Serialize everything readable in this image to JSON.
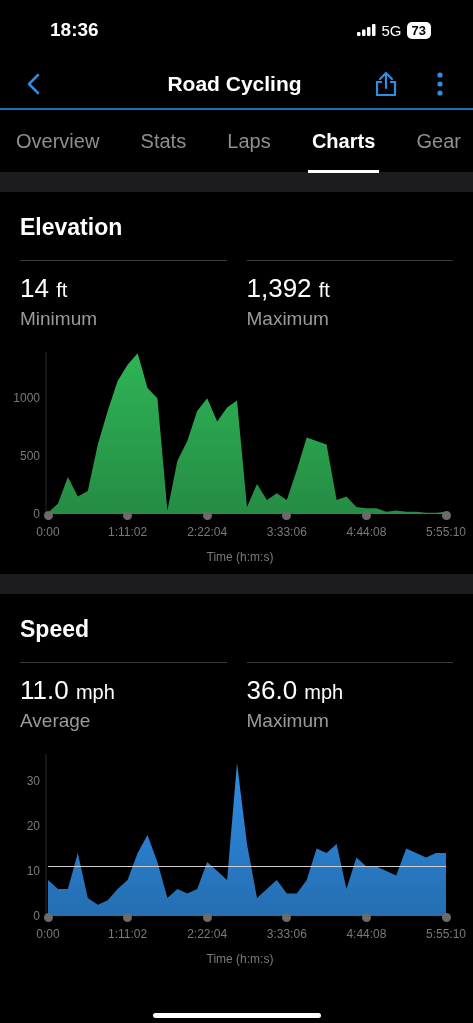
{
  "status_bar": {
    "time": "18:36",
    "network": "5G",
    "battery": "73"
  },
  "nav": {
    "title": "Road Cycling"
  },
  "tabs": [
    {
      "label": "Overview",
      "selected": false
    },
    {
      "label": "Stats",
      "selected": false
    },
    {
      "label": "Laps",
      "selected": false
    },
    {
      "label": "Charts",
      "selected": true
    },
    {
      "label": "Gear",
      "selected": false
    }
  ],
  "sections": [
    {
      "title": "Elevation",
      "stats": [
        {
          "value": "14",
          "unit": "ft",
          "label": "Minimum"
        },
        {
          "value": "1,392",
          "unit": "ft",
          "label": "Maximum"
        }
      ],
      "chart_data": {
        "type": "area",
        "xlabel": "Time (h:m:s)",
        "xlim": [
          0,
          21310
        ],
        "ylim": [
          0,
          1400
        ],
        "x": [
          0,
          533,
          1066,
          1598,
          2131,
          2664,
          3197,
          3729,
          4262,
          4795,
          5328,
          5860,
          6393,
          6926,
          7459,
          7991,
          8524,
          9057,
          9590,
          10122,
          10655,
          11188,
          11721,
          12253,
          12786,
          13319,
          13852,
          14384,
          14917,
          15450,
          15983,
          16515,
          17048,
          17581,
          18114,
          18646,
          19179,
          19712,
          20245,
          20777,
          21310
        ],
        "series": [
          {
            "color": "#2fb457",
            "values": [
              10,
              90,
              320,
              150,
              200,
              600,
              890,
              1150,
              1290,
              1390,
              1090,
              1000,
              30,
              460,
              630,
              890,
              1000,
              800,
              920,
              980,
              60,
              260,
              120,
              180,
              120,
              380,
              660,
              630,
              600,
              120,
              150,
              60,
              50,
              50,
              20,
              30,
              20,
              20,
              10,
              10,
              20
            ]
          }
        ],
        "xticks": [
          {
            "value": 0,
            "label": "0:00"
          },
          {
            "value": 4262,
            "label": "1:11:02"
          },
          {
            "value": 8524,
            "label": "2:22:04"
          },
          {
            "value": 12786,
            "label": "3:33:06"
          },
          {
            "value": 17048,
            "label": "4:44:08"
          },
          {
            "value": 21310,
            "label": "5:55:10"
          }
        ],
        "yticks": [
          0,
          500,
          1000
        ]
      }
    },
    {
      "title": "Speed",
      "stats": [
        {
          "value": "11.0",
          "unit": "mph",
          "label": "Average"
        },
        {
          "value": "36.0",
          "unit": "mph",
          "label": "Maximum"
        }
      ],
      "chart_data": {
        "type": "area",
        "xlabel": "Time (h:m:s)",
        "xlim": [
          0,
          21310
        ],
        "ylim": [
          0,
          36
        ],
        "x": [
          0,
          533,
          1066,
          1598,
          2131,
          2664,
          3197,
          3729,
          4262,
          4795,
          5328,
          5860,
          6393,
          6926,
          7459,
          7991,
          8524,
          9057,
          9590,
          10122,
          10655,
          11188,
          11721,
          12253,
          12786,
          13319,
          13852,
          14384,
          14917,
          15450,
          15983,
          16515,
          17048,
          17581,
          18114,
          18646,
          19179,
          19712,
          20245,
          20777,
          21310
        ],
        "series": [
          {
            "color": "#2f8de4",
            "values": [
              8,
              6,
              6,
              14,
              4,
              2.5,
              3.5,
              6,
              8,
              14,
              18,
              12,
              4,
              6,
              5,
              6,
              12,
              10,
              8,
              34,
              16,
              4,
              6,
              8,
              5,
              5,
              8,
              15,
              14,
              16,
              6,
              13,
              11,
              11,
              10,
              9,
              15,
              14,
              13,
              14,
              14
            ]
          }
        ],
        "xticks": [
          {
            "value": 0,
            "label": "0:00"
          },
          {
            "value": 4262,
            "label": "1:11:02"
          },
          {
            "value": 8524,
            "label": "2:22:04"
          },
          {
            "value": 12786,
            "label": "3:33:06"
          },
          {
            "value": 17048,
            "label": "4:44:08"
          },
          {
            "value": 21310,
            "label": "5:55:10"
          }
        ],
        "yticks": [
          0,
          10,
          20,
          30
        ],
        "ref_lines": [
          {
            "axis": "y",
            "value": 11
          }
        ]
      }
    }
  ]
}
